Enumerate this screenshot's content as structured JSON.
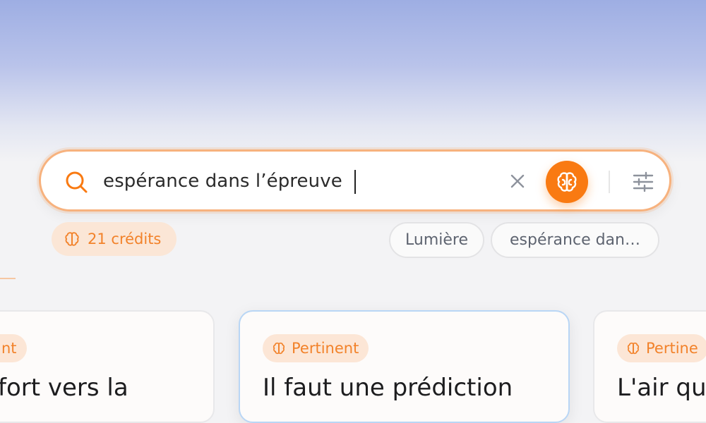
{
  "search": {
    "value": "espérance dans l’épreuve"
  },
  "credits": {
    "label": "21 crédits"
  },
  "recent_chips": [
    "Lumière",
    "espérance dan…"
  ],
  "cards": [
    {
      "tag": "nt",
      "title": "fort vers la"
    },
    {
      "tag": "Pertinent",
      "title": "Il faut une prédiction"
    },
    {
      "tag": "Pertine",
      "title": "L'air qu"
    }
  ],
  "colors": {
    "accent": "#f97a12",
    "accent_soft": "#fce6d6",
    "focus_border": "#f7b27e",
    "selected_card_border": "#b9d6f5",
    "gradient_top": "#9eaee3"
  },
  "icons": {
    "search": "search-icon",
    "clear": "close-icon",
    "ai": "brain-icon",
    "filters": "sliders-icon"
  }
}
